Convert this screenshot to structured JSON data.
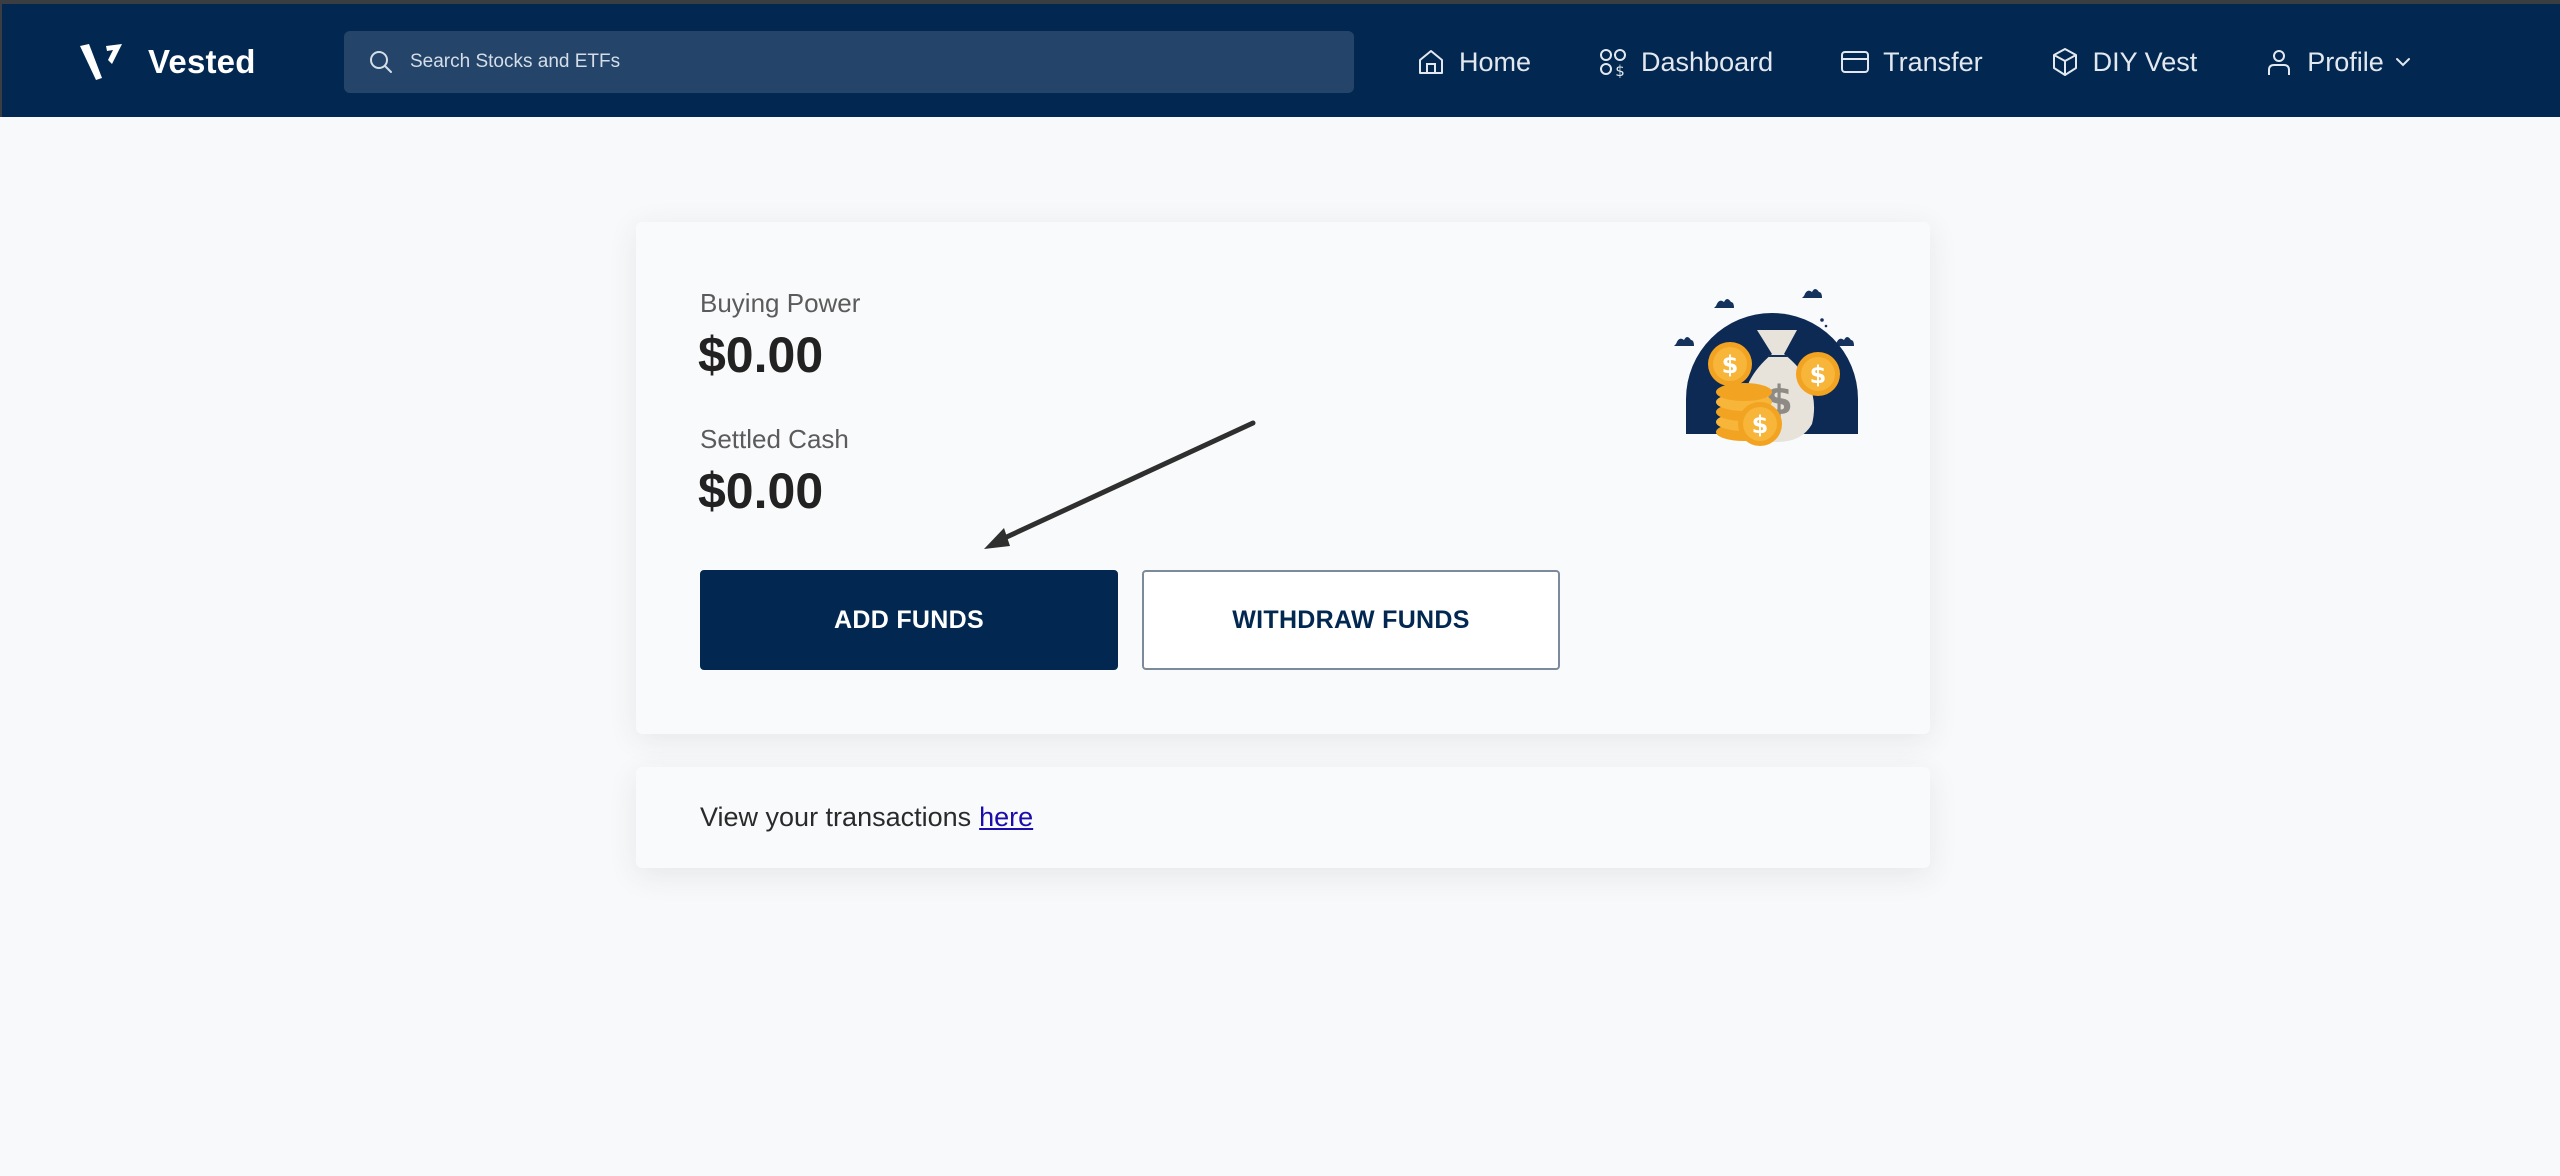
{
  "header": {
    "brand": "Vested",
    "search": {
      "placeholder": "Search Stocks and ETFs",
      "value": ""
    },
    "nav": [
      {
        "label": "Home",
        "icon": "home-icon"
      },
      {
        "label": "Dashboard",
        "icon": "dashboard-icon"
      },
      {
        "label": "Transfer",
        "icon": "card-icon"
      },
      {
        "label": "DIY Vest",
        "icon": "cube-icon"
      },
      {
        "label": "Profile",
        "icon": "user-icon",
        "has_dropdown": true
      }
    ]
  },
  "funds": {
    "buying_power_label": "Buying Power",
    "buying_power_value": "$0.00",
    "settled_cash_label": "Settled Cash",
    "settled_cash_value": "$0.00",
    "add_funds_label": "ADD FUNDS",
    "withdraw_funds_label": "WITHDRAW FUNDS",
    "illustration": "money-bag-coins-icon"
  },
  "transactions": {
    "text": "View your transactions",
    "link_label": "here"
  },
  "annotation": {
    "type": "arrow",
    "points_to": "add-funds-button"
  },
  "colors": {
    "navbar": "#022851",
    "search_bg": "#244569",
    "primary_button": "#022851",
    "link": "#1a0dab",
    "coin": "#f5a623"
  }
}
